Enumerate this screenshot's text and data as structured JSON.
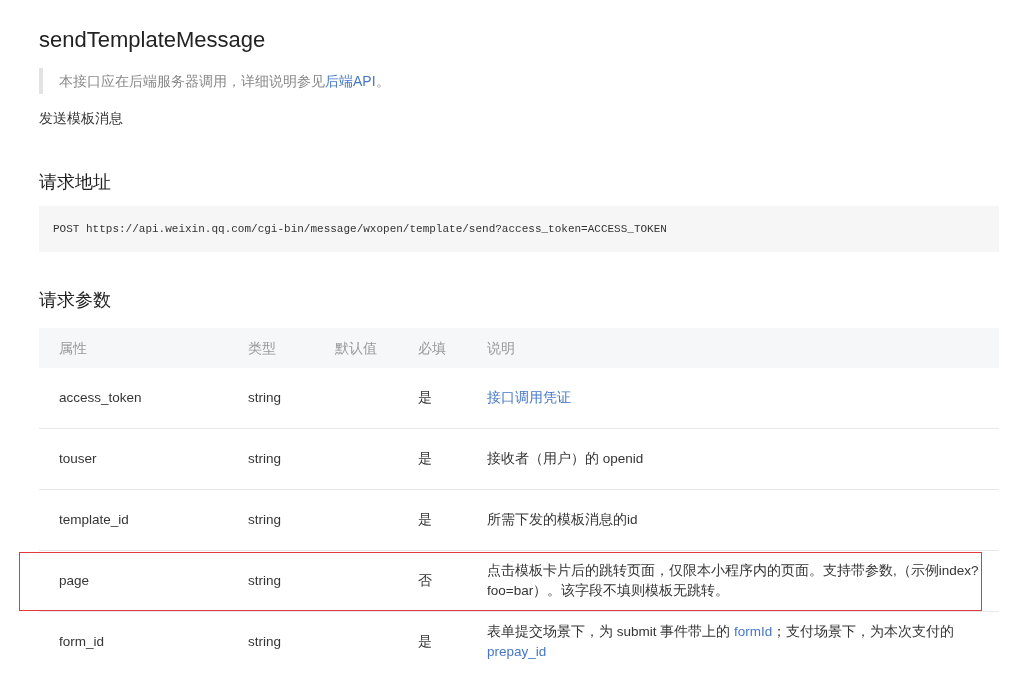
{
  "title": "sendTemplateMessage",
  "note": [
    {
      "text": "本接口应在后端服务器调用，详细说明参见",
      "link": false
    },
    {
      "text": "后端API",
      "link": true
    },
    {
      "text": "。",
      "link": false
    }
  ],
  "summary": "发送模板消息",
  "request_url": {
    "heading": "请求地址",
    "code": "POST https://api.weixin.qq.com/cgi-bin/message/wxopen/template/send?access_token=ACCESS_TOKEN"
  },
  "params": {
    "heading": "请求参数",
    "columns": [
      "属性",
      "类型",
      "默认值",
      "必填",
      "说明"
    ],
    "rows": [
      {
        "name": "access_token",
        "type": "string",
        "default": "",
        "required": "是",
        "highlighted": false,
        "description": [
          {
            "text": "接口调用凭证",
            "link": true
          }
        ]
      },
      {
        "name": "touser",
        "type": "string",
        "default": "",
        "required": "是",
        "highlighted": false,
        "description": [
          {
            "text": "接收者（用户）的 openid",
            "link": false
          }
        ]
      },
      {
        "name": "template_id",
        "type": "string",
        "default": "",
        "required": "是",
        "highlighted": false,
        "description": [
          {
            "text": "所需下发的模板消息的id",
            "link": false
          }
        ]
      },
      {
        "name": "page",
        "type": "string",
        "default": "",
        "required": "否",
        "highlighted": true,
        "description": [
          {
            "text": "点击模板卡片后的跳转页面，仅限本小程序内的页面。支持带参数,（示例index?foo=bar）。该字段不填则模板无跳转。",
            "link": false
          }
        ]
      },
      {
        "name": "form_id",
        "type": "string",
        "default": "",
        "required": "是",
        "highlighted": false,
        "description": [
          {
            "text": "表单提交场景下，为 submit 事件带上的 ",
            "link": false
          },
          {
            "text": "formId",
            "link": true
          },
          {
            "text": "；支付场景下，为本次支付的 ",
            "link": false
          },
          {
            "text": "prepay_id",
            "link": true
          }
        ]
      }
    ]
  }
}
